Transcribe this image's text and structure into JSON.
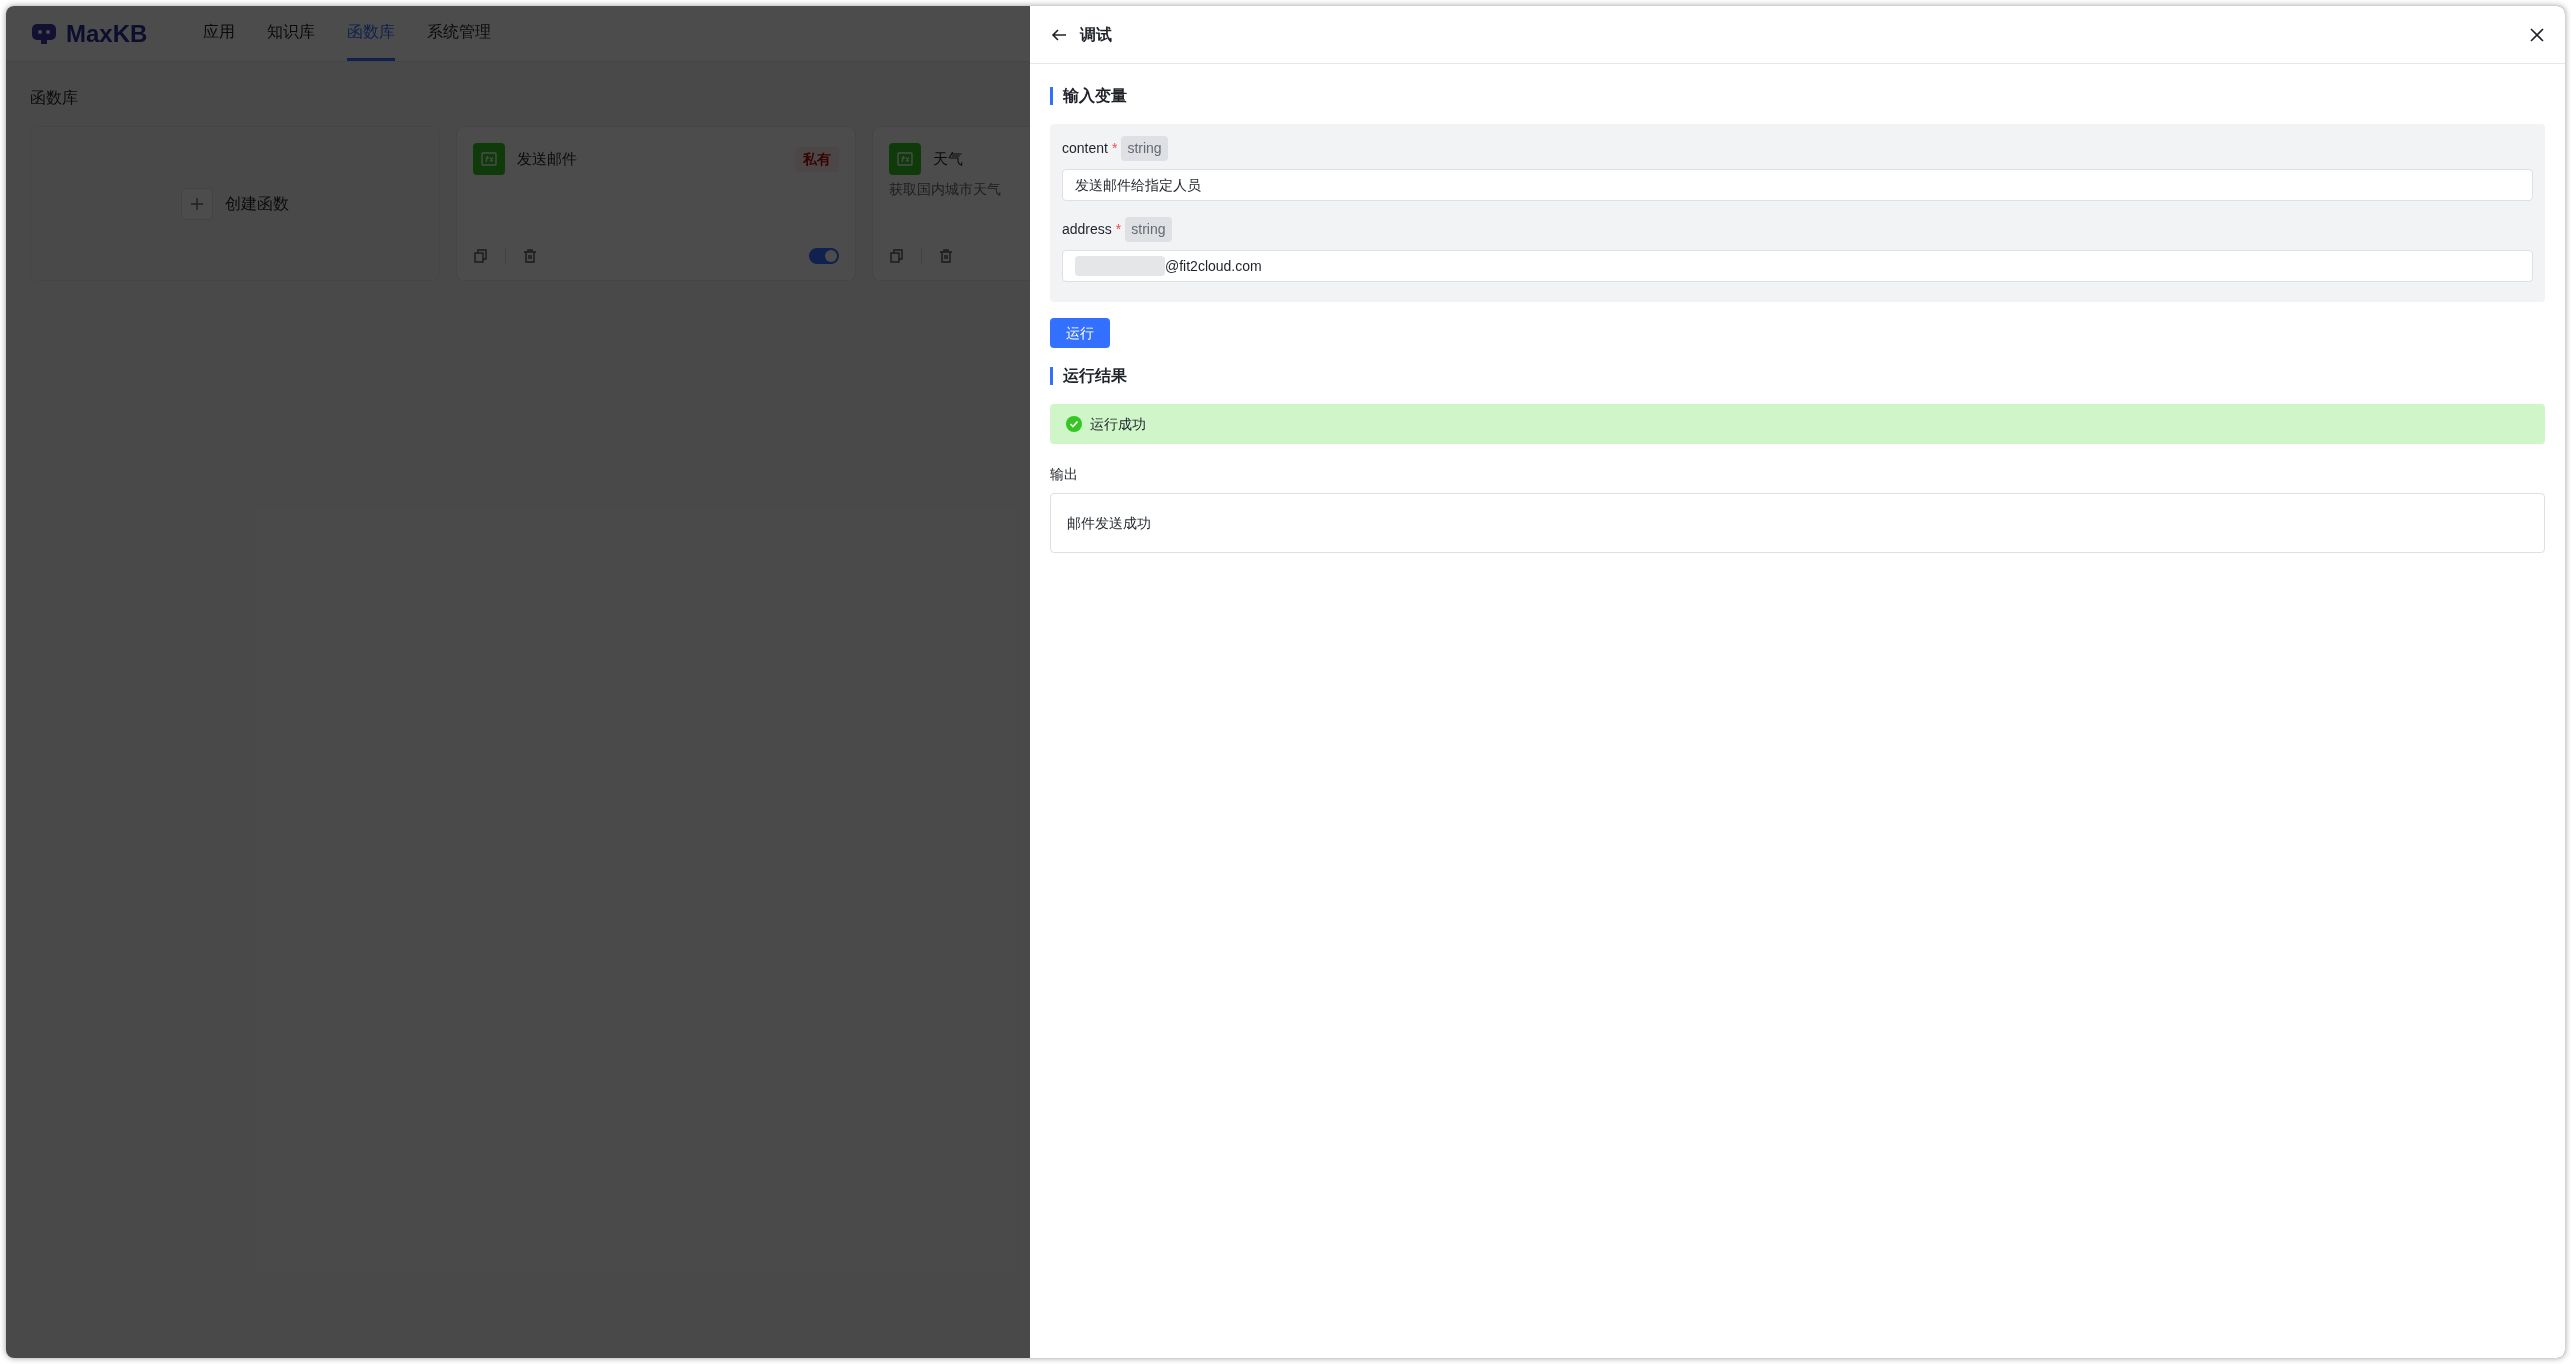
{
  "nav": {
    "logo": "MaxKB",
    "tabs": [
      {
        "label": "应用",
        "selected": false
      },
      {
        "label": "知识库",
        "selected": false
      },
      {
        "label": "函数库",
        "selected": true
      },
      {
        "label": "系统管理",
        "selected": false
      }
    ]
  },
  "page_title": "函数库",
  "create_card": {
    "label": "创建函数"
  },
  "functions": [
    {
      "name": "发送邮件",
      "badge": "私有",
      "enabled": true
    },
    {
      "name": "天气",
      "description": "获取国内城市天气"
    }
  ],
  "drawer": {
    "title": "调试",
    "input_section": {
      "heading": "输入变量",
      "fields": [
        {
          "name": "content",
          "required_mark": "*",
          "type": "string",
          "value": "发送邮件给指定人员",
          "redacted": false
        },
        {
          "name": "address",
          "required_mark": "*",
          "type": "string",
          "value": "@fit2cloud.com",
          "redacted": true
        }
      ]
    },
    "run_button": "运行",
    "result_section": {
      "heading": "运行结果",
      "status": {
        "kind": "success",
        "text": "运行成功"
      },
      "output_label": "输出",
      "output": "邮件发送成功"
    }
  }
}
